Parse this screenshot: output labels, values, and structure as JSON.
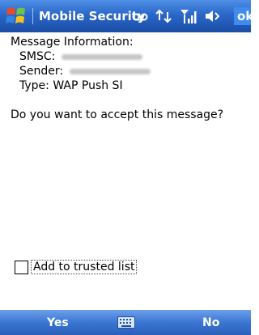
{
  "titlebar": {
    "app_title": "Mobile Security",
    "ok_label": "ok",
    "icons": [
      "windows-start-icon",
      "voicemail-icon",
      "connectivity-icon",
      "signal-strength-icon",
      "volume-icon"
    ]
  },
  "message": {
    "heading": "Message Information:",
    "smsc_label": "SMSC:",
    "sender_label": "Sender:",
    "type_label": "Type: WAP Push SI",
    "question": "Do you want to accept this message?"
  },
  "trusted": {
    "checkbox_label": "Add to trusted list",
    "checked": false
  },
  "softkeys": {
    "left": "Yes",
    "right": "No",
    "center_icon": "keyboard-icon"
  },
  "colors": {
    "titlebar": "#2a67c8",
    "softbar": "#3b76d4",
    "ok_button": "#3f8bf0"
  }
}
